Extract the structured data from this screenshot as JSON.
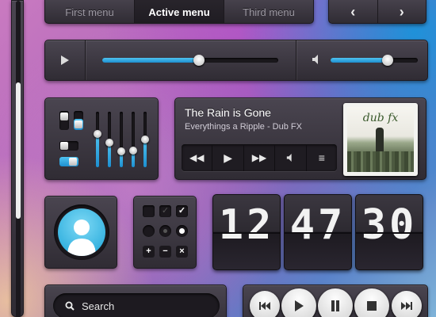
{
  "menu": {
    "items": [
      "First menu",
      "Active menu",
      "Third menu"
    ],
    "active_index": 1
  },
  "nav": {
    "prev_icon": "‹",
    "next_icon": "›"
  },
  "player_bar": {
    "play_icon": "▶",
    "seek_progress": 0.55,
    "volume_icon": "🔈",
    "volume_level": 0.65
  },
  "equalizer": {
    "bands": [
      0.6,
      0.45,
      0.28,
      0.3,
      0.5
    ],
    "toggles": [
      {
        "state": "off"
      },
      {
        "state": "on"
      }
    ],
    "vertical_toggles": [
      {
        "level": 0.2
      },
      {
        "level": 0.8
      }
    ]
  },
  "now_playing": {
    "title": "The Rain is Gone",
    "artist_album": "Everythings a Ripple - Dub FX",
    "cover_text": "dub fx",
    "controls": [
      "rewind",
      "play",
      "forward",
      "volume",
      "menu"
    ]
  },
  "checkboxes": {
    "unchecked": "",
    "partial": "✓",
    "checked": "✓"
  },
  "buttons": {
    "plus": "+",
    "minus": "−",
    "close": "×"
  },
  "clock": {
    "hours": "12",
    "minutes": "47",
    "seconds": "30"
  },
  "search": {
    "label": "Search"
  },
  "transport": [
    "prev",
    "play",
    "pause",
    "stop",
    "next"
  ],
  "colors": {
    "accent": "#2aa5e0",
    "panel": "#3a363e"
  }
}
